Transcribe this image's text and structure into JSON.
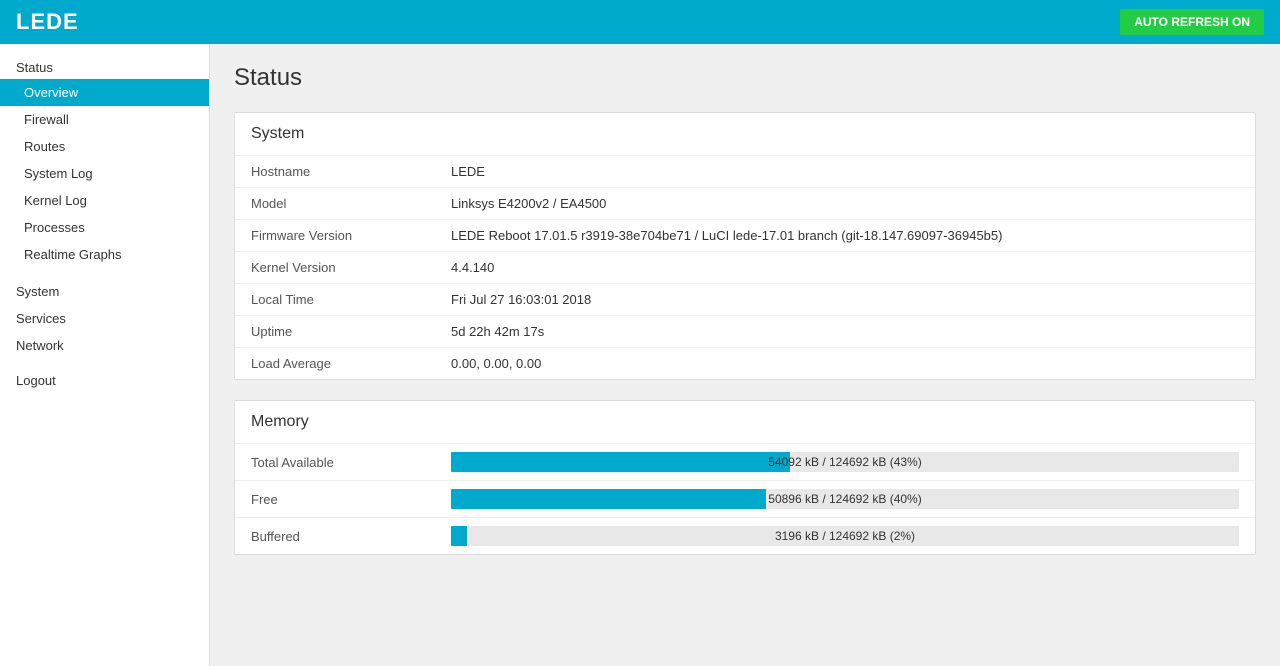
{
  "header": {
    "logo": "LEDE",
    "auto_refresh_label": "AUTO REFRESH ON"
  },
  "sidebar": {
    "status_label": "Status",
    "items_status": [
      {
        "id": "overview",
        "label": "Overview",
        "active": true
      },
      {
        "id": "firewall",
        "label": "Firewall",
        "active": false
      },
      {
        "id": "routes",
        "label": "Routes",
        "active": false
      },
      {
        "id": "system-log",
        "label": "System Log",
        "active": false
      },
      {
        "id": "kernel-log",
        "label": "Kernel Log",
        "active": false
      },
      {
        "id": "processes",
        "label": "Processes",
        "active": false
      },
      {
        "id": "realtime-graphs",
        "label": "Realtime Graphs",
        "active": false
      }
    ],
    "system_label": "System",
    "services_label": "Services",
    "network_label": "Network",
    "logout_label": "Logout"
  },
  "main": {
    "page_title": "Status",
    "system_section": {
      "title": "System",
      "rows": [
        {
          "label": "Hostname",
          "value": "LEDE"
        },
        {
          "label": "Model",
          "value": "Linksys E4200v2 / EA4500"
        },
        {
          "label": "Firmware Version",
          "value": "LEDE Reboot 17.01.5 r3919-38e704be71 / LuCI lede-17.01 branch (git-18.147.69097-36945b5)"
        },
        {
          "label": "Kernel Version",
          "value": "4.4.140"
        },
        {
          "label": "Local Time",
          "value": "Fri Jul 27 16:03:01 2018"
        },
        {
          "label": "Uptime",
          "value": "5d 22h 42m 17s"
        },
        {
          "label": "Load Average",
          "value": "0.00, 0.00, 0.00"
        }
      ]
    },
    "memory_section": {
      "title": "Memory",
      "rows": [
        {
          "label": "Total Available",
          "bar_pct": 43,
          "bar_label": "54092 kB / 124692 kB (43%)"
        },
        {
          "label": "Free",
          "bar_pct": 40,
          "bar_label": "50896 kB / 124692 kB (40%)"
        },
        {
          "label": "Buffered",
          "bar_pct": 2,
          "bar_label": "3196 kB / 124692 kB (2%)"
        }
      ]
    }
  }
}
